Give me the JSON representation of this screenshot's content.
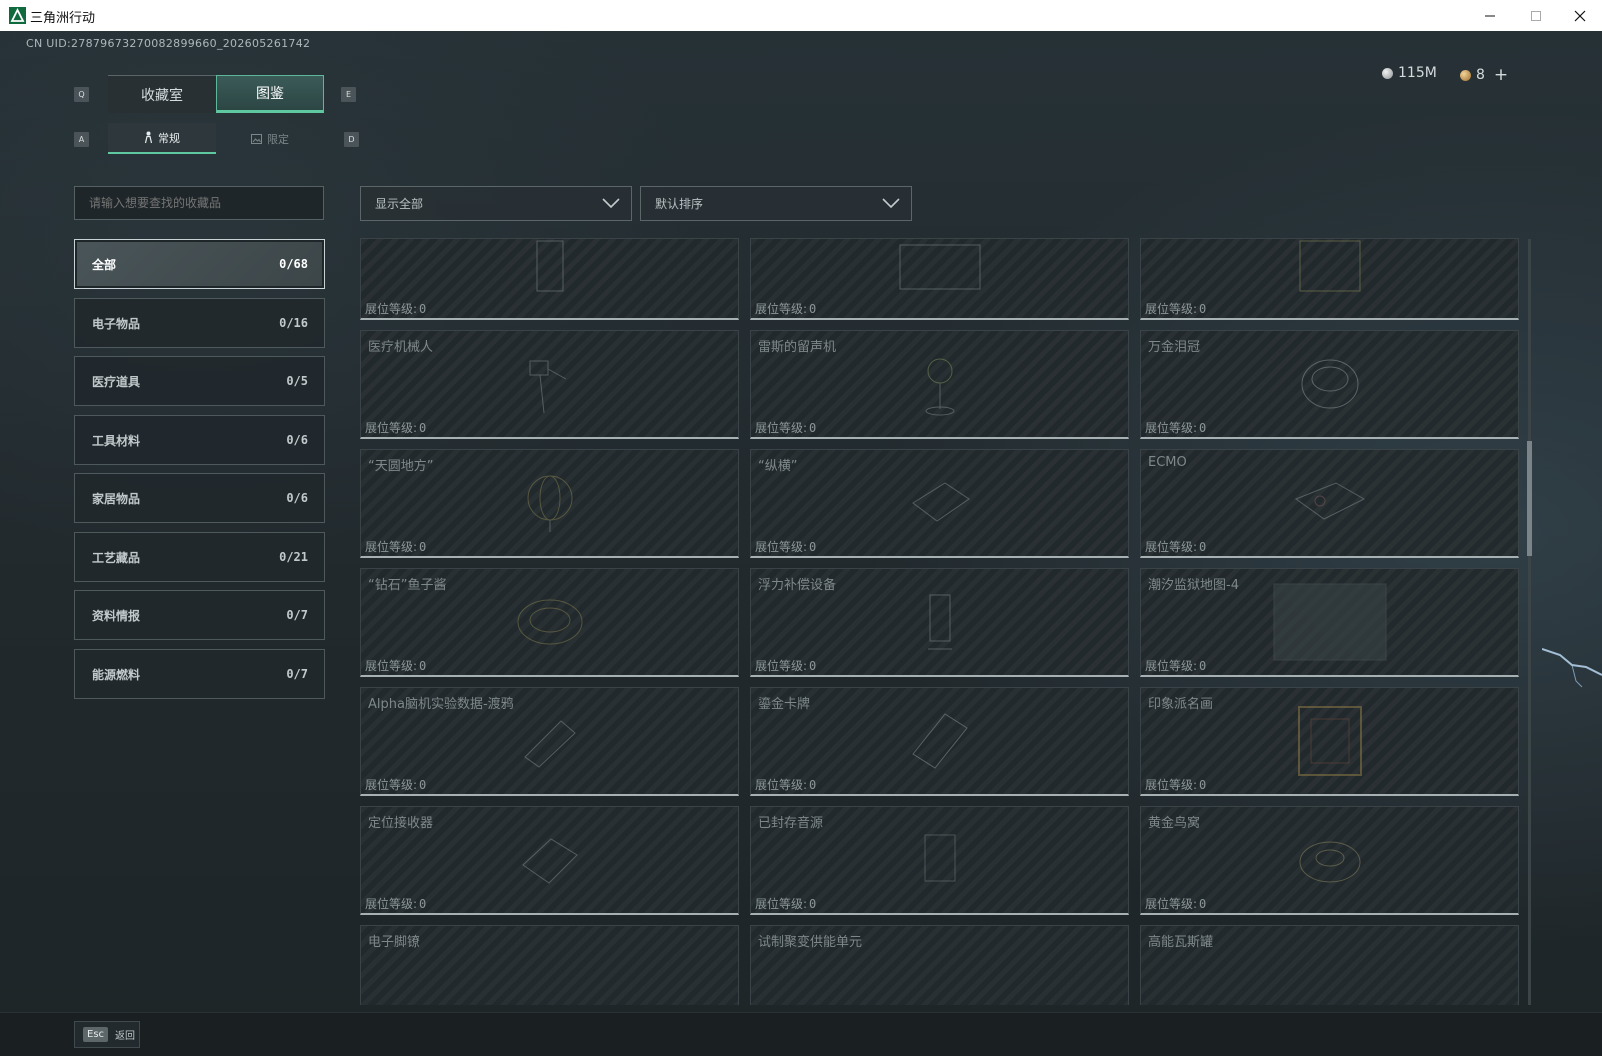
{
  "window": {
    "title": "三角洲行动"
  },
  "header": {
    "uid": "CN UID:27879673270082899660_202605261742"
  },
  "colors": {
    "accent": "#5fc8a0",
    "background": "#1f2629",
    "card_border": "#a7b1b4"
  },
  "tabs": {
    "main": [
      {
        "label": "收藏室",
        "active": false
      },
      {
        "label": "图鉴",
        "active": true
      }
    ],
    "main_prev_key": "Q",
    "main_next_key": "E",
    "sub": [
      {
        "label": "常规",
        "icon": "person-icon",
        "active": true
      },
      {
        "label": "限定",
        "icon": "image-icon",
        "active": false
      }
    ],
    "sub_prev_key": "A",
    "sub_next_key": "D"
  },
  "currency": [
    {
      "value": "115M",
      "icon": "silver-coin-icon"
    },
    {
      "value": "8",
      "icon": "gold-coin-icon"
    }
  ],
  "search": {
    "placeholder": "请输入想要查找的收藏品"
  },
  "filters": {
    "show": "显示全部",
    "sort": "默认排序"
  },
  "categories": [
    {
      "label": "全部",
      "count": "0/68",
      "active": true
    },
    {
      "label": "电子物品",
      "count": "0/16"
    },
    {
      "label": "医疗道具",
      "count": "0/5"
    },
    {
      "label": "工具材料",
      "count": "0/6"
    },
    {
      "label": "家居物品",
      "count": "0/6"
    },
    {
      "label": "工艺藏品",
      "count": "0/21"
    },
    {
      "label": "资料情报",
      "count": "0/7"
    },
    {
      "label": "能源燃料",
      "count": "0/7"
    }
  ],
  "level_label": "展位等级:",
  "items": [
    {
      "name": "",
      "level": "0"
    },
    {
      "name": "",
      "level": "0"
    },
    {
      "name": "",
      "level": "0"
    },
    {
      "name": "医疗机械人",
      "level": "0"
    },
    {
      "name": "雷斯的留声机",
      "level": "0"
    },
    {
      "name": "万金泪冠",
      "level": "0"
    },
    {
      "name": "“天圆地方”",
      "level": "0"
    },
    {
      "name": "“纵横”",
      "level": "0"
    },
    {
      "name": "ECMO",
      "level": "0"
    },
    {
      "name": "“钻石”鱼子酱",
      "level": "0"
    },
    {
      "name": "浮力补偿设备",
      "level": "0"
    },
    {
      "name": "潮汐监狱地图-4",
      "level": "0"
    },
    {
      "name": "Alpha脑机实验数据-渡鸦",
      "level": "0"
    },
    {
      "name": "鎏金卡牌",
      "level": "0"
    },
    {
      "name": "印象派名画",
      "level": "0"
    },
    {
      "name": "定位接收器",
      "level": "0"
    },
    {
      "name": "已封存音源",
      "level": "0"
    },
    {
      "name": "黄金鸟窝",
      "level": "0"
    },
    {
      "name": "电子脚镣",
      "level": ""
    },
    {
      "name": "试制聚变供能单元",
      "level": ""
    },
    {
      "name": "高能瓦斯罐",
      "level": ""
    }
  ],
  "footer": {
    "esc_key": "Esc",
    "back_label": "返回"
  }
}
